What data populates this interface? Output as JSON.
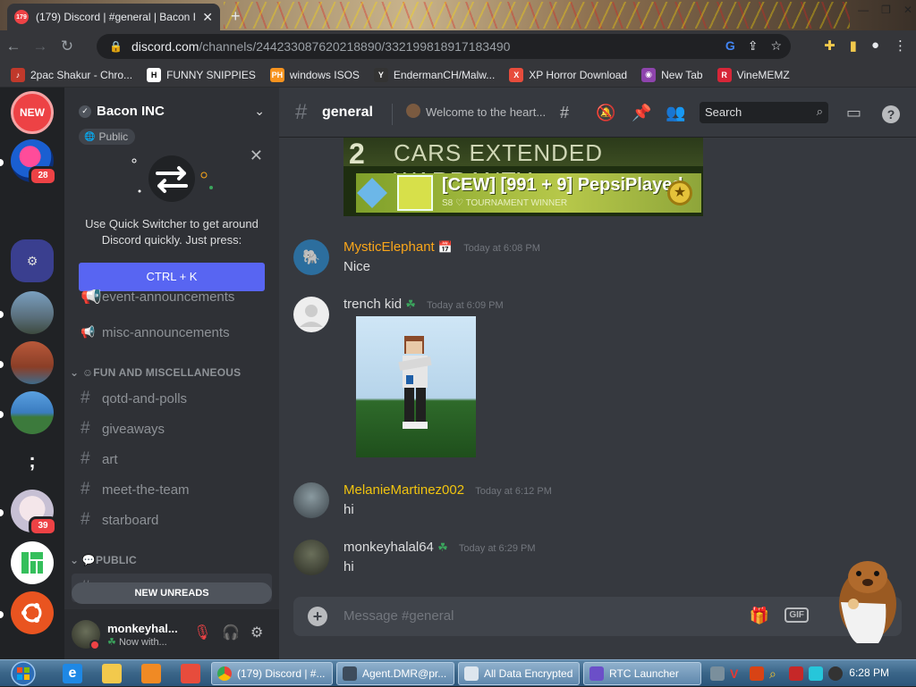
{
  "browser": {
    "tab_title": "(179) Discord | #general | Bacon I",
    "tab_badge": "179",
    "url_host": "discord.com",
    "url_path": "/channels/244233087620218890/332199818917183490",
    "bookmarks": [
      {
        "label": "2pac Shakur - Chro...",
        "icon": "tupac-icon",
        "color": "#c0392b",
        "glyph": "♪"
      },
      {
        "label": "FUNNY SNIPPIES",
        "icon": "h-icon",
        "color": "#ffffff",
        "glyph": "H"
      },
      {
        "label": "windows ISOS",
        "icon": "ph-icon",
        "color": "#f7931e",
        "glyph": "PH"
      },
      {
        "label": "EndermanCH/Malw...",
        "icon": "github-icon",
        "color": "#333333",
        "glyph": "Y"
      },
      {
        "label": "XP Horror Download",
        "icon": "x-icon",
        "color": "#e74c3c",
        "glyph": "X"
      },
      {
        "label": "New Tab",
        "icon": "globe-icon",
        "color": "#8e44ad",
        "glyph": "◉"
      },
      {
        "label": "VineMEMZ",
        "icon": "r-icon",
        "color": "#d72638",
        "glyph": "R"
      }
    ]
  },
  "guilds": {
    "new_badge": "NEW",
    "badges": [
      "28",
      "39"
    ]
  },
  "server": {
    "name": "Bacon INC",
    "public_label": "Public",
    "quick_switcher": {
      "text_line1": "Use Quick Switcher to get around",
      "text_line2": "Discord quickly. Just press:",
      "shortcut": "CTRL + K"
    },
    "channels_top": [
      {
        "name": "event-announcements",
        "icon": "megaphone-icon"
      },
      {
        "name": "misc-announcements",
        "icon": "megaphone-icon"
      }
    ],
    "category_fun": "FUN AND MISCELLANEOUS",
    "channels_fun": [
      "qotd-and-polls",
      "giveaways",
      "art",
      "meet-the-team",
      "starboard"
    ],
    "category_public": "PUBLIC",
    "channels_public": [
      "general"
    ],
    "new_unreads": "NEW UNREADS"
  },
  "user": {
    "name": "monkeyhal...",
    "status": "Now with..."
  },
  "channel": {
    "name": "general",
    "topic": "Welcome to the heart...",
    "search_placeholder": "Search"
  },
  "banner": {
    "title_number": "2",
    "title_text": "CARS EXTENDED WARRANTY",
    "player": "[CEW] [991 + 9] PepsiPlayed",
    "subtitle": "S8 ♡ TOURNAMENT WINNER"
  },
  "messages": [
    {
      "author": "MysticElephant",
      "color": "#faa61a",
      "time": "Today at 6:08 PM",
      "text": "Nice"
    },
    {
      "author": "trench kid",
      "color": "#b9bbbe",
      "time": "Today at 6:09 PM",
      "text": ""
    },
    {
      "author": "MelanieMartinez002",
      "color": "#f1c40f",
      "time": "Today at 6:12 PM",
      "text": "hi"
    },
    {
      "author": "monkeyhalal64",
      "color": "#b9bbbe",
      "time": "Today at 6:29 PM",
      "text": "hi"
    }
  ],
  "composer": {
    "placeholder": "Message #general",
    "gif_label": "GIF"
  },
  "taskbar": {
    "tasks": [
      "(179) Discord | #...",
      "Agent.DMR@pr...",
      "All Data Encrypted",
      "RTC Launcher"
    ],
    "clock": "6:28 PM"
  }
}
